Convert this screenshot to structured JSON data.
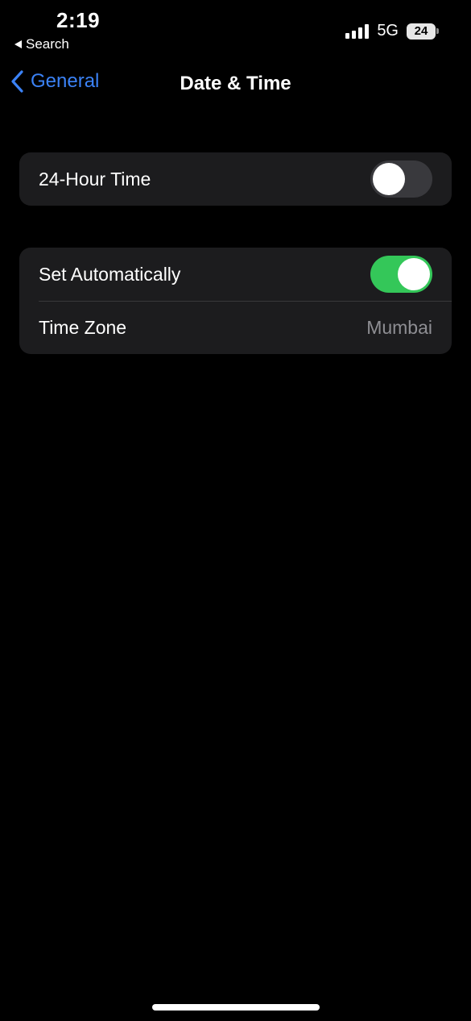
{
  "status_bar": {
    "time": "2:19",
    "back_app": "Search",
    "network": "5G",
    "battery": "24",
    "signal_bars": 4
  },
  "nav": {
    "back_label": "General",
    "title": "Date & Time",
    "accent_color": "#3b82f6"
  },
  "group1": {
    "rows": [
      {
        "label": "24-Hour Time",
        "toggle_on": false
      }
    ]
  },
  "group2": {
    "rows": [
      {
        "label": "Set Automatically",
        "toggle_on": true
      },
      {
        "label": "Time Zone",
        "value": "Mumbai"
      }
    ]
  },
  "colors": {
    "background": "#000000",
    "cell": "#1c1c1e",
    "toggle_on": "#34c759",
    "toggle_off": "#39393d",
    "secondary_text": "#8e8e93"
  }
}
